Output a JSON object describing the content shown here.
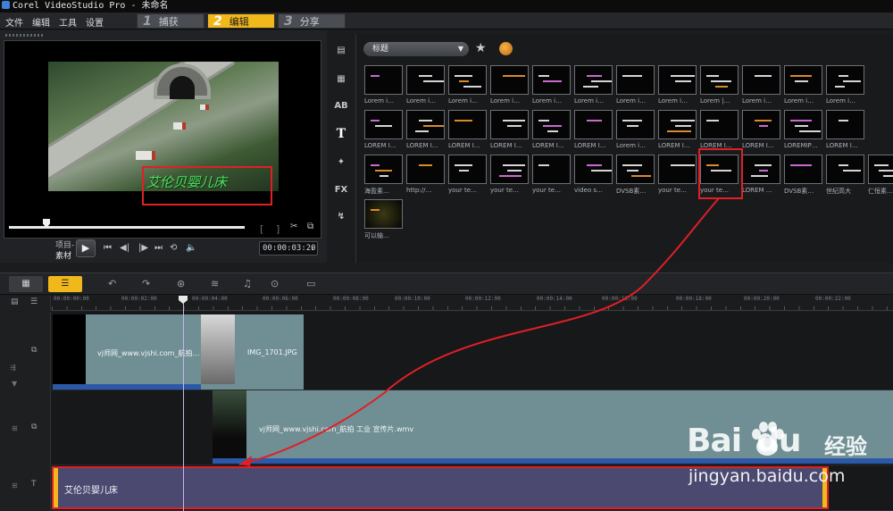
{
  "window": {
    "title": "Corel VideoStudio Pro - 未命名"
  },
  "menu": [
    "文件",
    "编辑",
    "工具",
    "设置"
  ],
  "steps": [
    {
      "num": "1",
      "label": "捕获",
      "active": false
    },
    {
      "num": "2",
      "label": "编辑",
      "active": true
    },
    {
      "num": "3",
      "label": "分享",
      "active": false
    }
  ],
  "preview": {
    "caption": "艾伦贝婴儿床",
    "mode_project": "项目-",
    "mode_clip": "素材",
    "timecode": "00:00:03:20",
    "bracket_in": "[",
    "bracket_out": "]"
  },
  "library": {
    "category": "标题",
    "tab_icons": [
      "media-icon",
      "transition-icon",
      "graphics-icon",
      "title-icon",
      "filter-icon",
      "fx-icon",
      "path-icon"
    ],
    "tab_labels": [
      "▤",
      "▦",
      "AB",
      "T",
      "✦",
      "FX",
      "↯"
    ],
    "row1_labels": [
      "Lorem i…",
      "Lorem i…",
      "Lorem i…",
      "Lorem i…",
      "Lorem i…",
      "Lorem i…",
      "Lorem i…",
      "Lorem i…",
      "Lorem |…",
      "Lorem i…",
      "Lorem i…",
      "Lorem i…"
    ],
    "row2_labels": [
      "LOREM I…",
      "LOREM I…",
      "LOREM I…",
      "LOREM I…",
      "LOREM I…",
      "LOREM I…",
      "Lorem i…",
      "LOREM I…",
      "LOREM I…",
      "LOREM I…",
      "LOREMIP…",
      "LOREM I…"
    ],
    "row3_labels": [
      "海盈素…",
      "http://…",
      "your te…",
      "your te…",
      "your te…",
      "video s…",
      "DVSB素…",
      "your te…",
      "your te…",
      "LOREM …",
      "DVSB素…",
      "世纪高大",
      "仁恒素…"
    ],
    "row4_labels": [
      "可以输…"
    ]
  },
  "timeline": {
    "ruler": [
      "00:00:00:00",
      "00:00:02:00",
      "00:00:04:00",
      "00:00:06:00",
      "00:00:08:00",
      "00:00:10:00",
      "00:00:12:00",
      "00:00:14:00",
      "00:00:16:00",
      "00:00:18:00",
      "00:00:20:00",
      "00:00:22:00"
    ],
    "video_track": {
      "clip1": "vj师网_www.vjshi.com_航拍…",
      "clip2": "IMG_1701.JPG"
    },
    "overlay_track": {
      "clip": "vj师网_www.vjshi.com_航拍 工业 宣传片.wmv"
    },
    "title_track": {
      "clip": "艾伦贝婴儿床"
    }
  },
  "watermark": {
    "logo": "Bai",
    "logo2": "du",
    "cn": "经验",
    "url": "jingyan.baidu.com"
  },
  "colors": {
    "accent": "#f1b81c",
    "annotation": "#e01f26",
    "clip": "#6f8f94",
    "title_clip": "#4b4970"
  }
}
